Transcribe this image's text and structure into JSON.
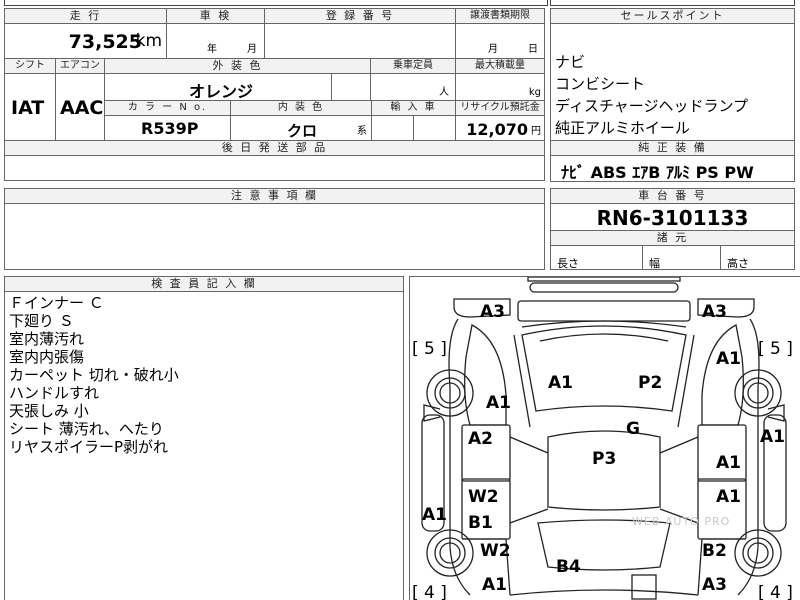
{
  "header": {
    "mileage_label": "走 行",
    "shaken_label": "車 検",
    "registration_label": "登 録 番 号",
    "transfer_label": "譲渡書類期限",
    "sales_point_label": "セールスポイント"
  },
  "mileage": {
    "value": "73,525",
    "unit": "km"
  },
  "shaken": {
    "year_unit": "年",
    "month_unit": "月"
  },
  "transfer": {
    "month_unit": "月",
    "day_unit": "日"
  },
  "row2": {
    "shift_label": "シフト",
    "ac_label": "エアコン",
    "ext_color_label": "外 装 色",
    "capacity_label": "乗車定員",
    "max_load_label": "最大積載量",
    "shift_value": "IAT",
    "ac_value": "AAC",
    "ext_color_value": "オレンジ",
    "capacity_unit": "人",
    "load_unit": "kg",
    "color_no_label": "カ ラ ー N o.",
    "interior_label": "内 装 色",
    "import_label": "輸 入 車",
    "recycle_label": "リサイクル預託金",
    "color_no_value": "R539P",
    "interior_value": "クロ",
    "interior_suffix": "系",
    "recycle_value": "12,070",
    "recycle_unit": "円"
  },
  "later_parts_label": "後 日 発 送 部 品",
  "sales_points": [
    "ナビ",
    "コンビシート",
    "ディスチャージヘッドランプ",
    "純正アルミホイール"
  ],
  "equipment": {
    "label": "純 正 装 備",
    "value": "ﾅﾋﾞ ABS ｴｱB ｱﾙﾐ PS PW"
  },
  "notes_label": "注 意 事 項 欄",
  "chassis": {
    "label": "車 台 番 号",
    "value": "RN6-3101133"
  },
  "dimensions": {
    "label": "諸 元",
    "length": "長さ",
    "width": "幅",
    "height": "高さ"
  },
  "inspector": {
    "label": "検 査 員 記 入 欄",
    "lines": [
      "Ｆインナー Ｃ",
      "下廻り Ｓ",
      "室内薄汚れ",
      "室内内張傷",
      "カーペット 切れ・破れ小",
      "ハンドルすれ",
      "天張しみ 小",
      "シート 薄汚れ、へたり",
      "リヤスポイラーP剥がれ"
    ]
  },
  "damage_map": {
    "watermark": "WEB AUTO PRO",
    "marks": [
      "A3",
      "A3",
      "A1",
      "A1",
      "A1",
      "P2",
      "A1",
      "A1",
      "G",
      "A2",
      "P3",
      "A1",
      "W2",
      "A1",
      "B1",
      "A1",
      "W2",
      "B2",
      "B4",
      "A1",
      "A3"
    ],
    "tires": [
      "[ 5 ]",
      "[ 5 ]",
      "[ 4 ]",
      "[ 4 ]"
    ]
  }
}
